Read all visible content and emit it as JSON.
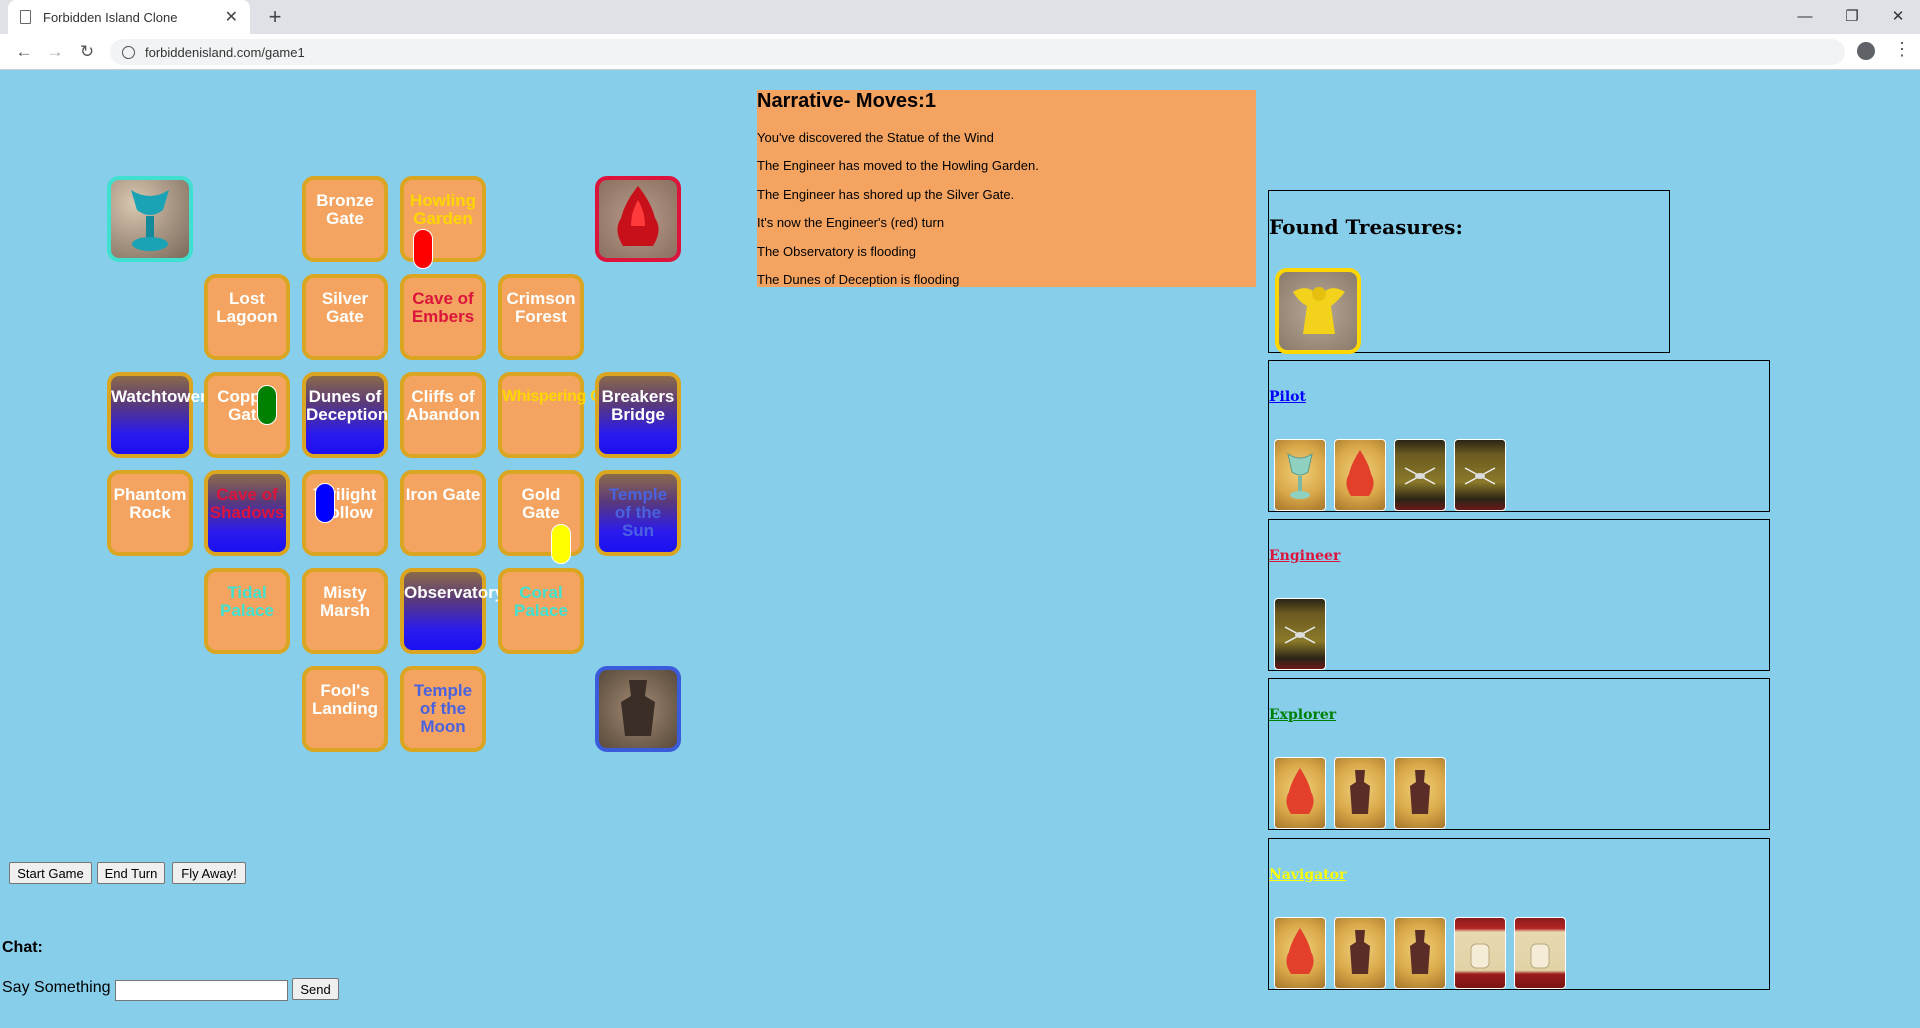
{
  "browser": {
    "tab_title": "Forbidden Island Clone",
    "url": "forbiddenisland.com/game1"
  },
  "board": {
    "tiles": {
      "bronze_gate": "Bronze Gate",
      "howling_garden": "Howling Garden",
      "lost_lagoon": "Lost Lagoon",
      "silver_gate": "Silver Gate",
      "cave_of_embers": "Cave of Embers",
      "crimson_forest": "Crimson Forest",
      "watchtower": "Watchtower",
      "copper_gate": "Copper Gate",
      "dunes_of_deception": "Dunes of Deception",
      "cliffs_of_abandon": "Cliffs of Abandon",
      "whispering_garden": "Whispering Garden",
      "breakers_bridge": "Breakers Bridge",
      "phantom_rock": "Phantom Rock",
      "cave_of_shadows": "Cave of Shadows",
      "twilight_hollow": "Twilight Hollow",
      "iron_gate": "Iron Gate",
      "gold_gate": "Gold Gate",
      "temple_of_the_sun": "Temple of the Sun",
      "tidal_palace": "Tidal Palace",
      "misty_marsh": "Misty Marsh",
      "observatory": "Observatory",
      "coral_palace": "Coral Palace",
      "fools_landing": "Fool's Landing",
      "temple_of_the_moon": "Temple of the Moon"
    },
    "treasure_colors": {
      "chalice": "#40e0d0",
      "crystal": "#dc143c",
      "earth": "#3b5bdb"
    },
    "pawn_colors": {
      "engineer": "#ff0000",
      "explorer": "#008000",
      "pilot": "#0000ff",
      "navigator": "#ffff00"
    }
  },
  "narrative": {
    "title": "Narrative- Moves:1",
    "lines": [
      "You've discovered the Statue of the Wind",
      "The Engineer has moved to the Howling Garden.",
      "The Engineer has shored up the Silver Gate.",
      "It's now the Engineer's (red) turn",
      "The Observatory is flooding",
      "The Dunes of Deception is flooding"
    ]
  },
  "found_treasures": {
    "title": "Found Treasures:"
  },
  "players": [
    {
      "name": "Pilot",
      "color": "#0000ff"
    },
    {
      "name": "Engineer",
      "color": "#dc143c"
    },
    {
      "name": "Explorer",
      "color": "#008000"
    },
    {
      "name": "Navigator",
      "color": "#ffff00"
    }
  ],
  "controls": {
    "start_game": "Start Game",
    "end_turn": "End Turn",
    "fly_away": "Fly Away!",
    "chat_label": "Chat:",
    "say_label": "Say Something",
    "send": "Send"
  }
}
